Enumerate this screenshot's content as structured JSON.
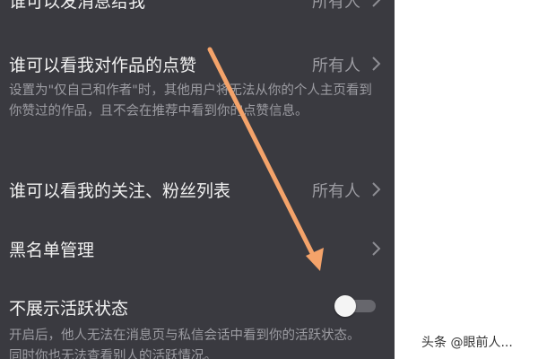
{
  "settings": {
    "rows": [
      {
        "title": "谁可以发消息给我",
        "value": "所有人"
      },
      {
        "title": "谁可以看我对作品的点赞",
        "value": "所有人",
        "description": "设置为\"仅自己和作者\"时，其他用户将无法从你的个人主页看到你赞过的作品，且不会在推荐中看到你的点赞信息。"
      },
      {
        "title": "谁可以看我的关注、粉丝列表",
        "value": "所有人"
      },
      {
        "title": "黑名单管理"
      },
      {
        "title": "不展示活跃状态",
        "toggle_on": false,
        "description": "开启后，他人无法在消息页与私信会话中看到你的活跃状态。同时你也无法查看别人的活跃情况。"
      }
    ]
  },
  "annotation": {
    "arrow_color": "#f4a36a"
  },
  "watermark": {
    "text": "头条 @眼前人..."
  },
  "colors": {
    "background": "#3a3a40",
    "text": "#f1f1f1",
    "secondary": "#9c9ca2"
  }
}
